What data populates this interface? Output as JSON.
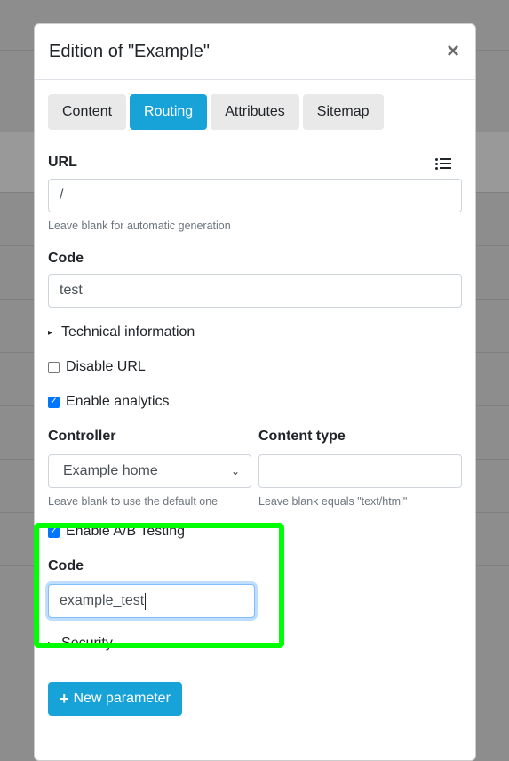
{
  "modal": {
    "title": "Edition of \"Example\"",
    "close_glyph": "×"
  },
  "tabs": [
    {
      "label": "Content",
      "active": false
    },
    {
      "label": "Routing",
      "active": true
    },
    {
      "label": "Attributes",
      "active": false
    },
    {
      "label": "Sitemap",
      "active": false
    }
  ],
  "url": {
    "label": "URL",
    "value": "/",
    "help": "Leave blank for automatic generation",
    "icon": "list-icon"
  },
  "code": {
    "label": "Code",
    "value": "test"
  },
  "technical": {
    "label": "Technical information",
    "marker": "▸"
  },
  "disable_url": {
    "label": "Disable URL",
    "checked": false
  },
  "analytics": {
    "label": "Enable analytics",
    "checked": true
  },
  "controller": {
    "label": "Controller",
    "value": "Example home",
    "help": "Leave blank to use the default one"
  },
  "content_type": {
    "label": "Content type",
    "value": "",
    "help": "Leave blank equals \"text/html\""
  },
  "ab_testing": {
    "label": "Enable A/B Testing",
    "checked": true,
    "code_label": "Code",
    "code_value": "example_test"
  },
  "security": {
    "label": "Security",
    "marker": "▸"
  },
  "new_parameter": {
    "label": "New parameter",
    "icon": "plus-icon"
  },
  "colors": {
    "accent": "#17a2d8",
    "highlight": "#00ff00",
    "checkbox": "#0075ff"
  }
}
